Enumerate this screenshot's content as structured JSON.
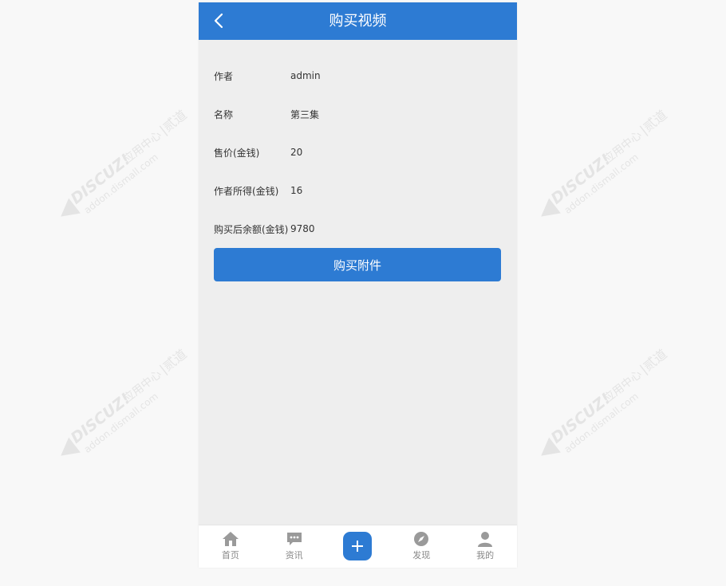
{
  "header": {
    "title": "购买视频",
    "back_icon": "chevron-left-icon"
  },
  "info_rows": [
    {
      "label": "作者",
      "value": "admin"
    },
    {
      "label": "名称",
      "value": "第三集"
    },
    {
      "label": "售价(金钱)",
      "value": "20"
    },
    {
      "label": "作者所得(金钱)",
      "value": "16"
    },
    {
      "label": "购买后余额(金钱)",
      "value": "9780"
    }
  ],
  "buy_button": {
    "label": "购买附件"
  },
  "tabbar": {
    "items": [
      {
        "label": "首页",
        "icon": "home-icon"
      },
      {
        "label": "资讯",
        "icon": "chat-icon"
      },
      {
        "label": "",
        "icon": "plus-icon"
      },
      {
        "label": "发现",
        "icon": "compass-icon"
      },
      {
        "label": "我的",
        "icon": "user-icon"
      }
    ]
  },
  "watermark": {
    "brand": "DISCUZ!",
    "text_cn": "应用中心",
    "site": "addon.dismall.com",
    "suffix": "贰道"
  },
  "colors": {
    "accent": "#2d7bd3",
    "page_bg": "#eeeeee",
    "tab_label": "#888888"
  }
}
